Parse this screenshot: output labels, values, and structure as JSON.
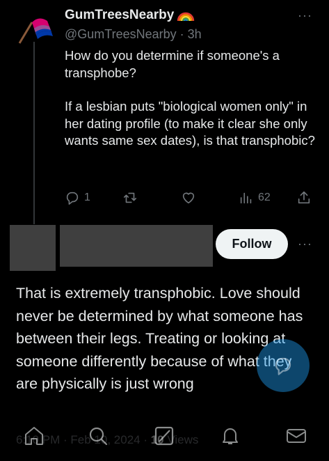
{
  "tweet": {
    "display_name": "GumTreesNearby",
    "handle_time": "@GumTreesNearby · 3h",
    "paragraphs": [
      "How do you determine if someone's a transphobe?",
      "If a lesbian puts \"biological women only\" in her dating profile (to make it clear she only wants same sex dates), is that transphobic?"
    ],
    "reply_count": "1",
    "view_count": "62",
    "more_label": "···"
  },
  "reply": {
    "follow_label": "Follow",
    "more_label": "···",
    "text": "That is extremely transphobic. Love should never be determined by what someone has between their legs. Treating or looking at someone differently because of what they are physically is just wrong",
    "timestamp": "6:10 PM · Feb 10, 2024 · ",
    "views_count": "10",
    "views_label": " Views"
  },
  "icons": {
    "avatar": "bisexual-flag-icon",
    "name_badge": "rainbow-icon",
    "reply": "reply-icon",
    "retweet": "retweet-icon",
    "like": "heart-icon",
    "views": "analytics-icon",
    "share": "share-icon",
    "compose_fab": "compose-reply-icon",
    "nav": [
      "home-icon",
      "search-icon",
      "grok-icon",
      "notifications-icon",
      "messages-icon"
    ]
  },
  "colors": {
    "background": "#000000",
    "text": "#e7e9ea",
    "secondary": "#71767b",
    "accent": "#1d9bf0",
    "redaction": "#3f3f3f"
  }
}
